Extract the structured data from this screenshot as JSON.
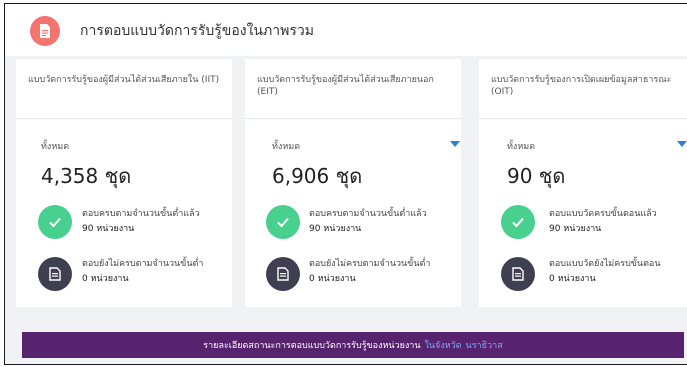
{
  "header": {
    "title": "การตอบแบบวัดการรับรู้ของในภาพรวม",
    "icon": "document-icon",
    "icon_color": "#f47570"
  },
  "cards": [
    {
      "title": "แบบวัดการรับรู้ของผู้มีส่วนได้ส่วนเสียภายใน (IIT)",
      "total_label": "ทั้งหมด",
      "total": "4,358 ชุด",
      "done_label": "ตอบครบตามจำนวนขั้นต่ำแล้ว",
      "done_value": "90 หน่วยงาน",
      "pending_label": "ตอบยังไม่ครบตามจำนวนขั้นต่ำ",
      "pending_value": "0 หน่วยงาน"
    },
    {
      "title": "แบบวัดการรับรู้ของผู้มีส่วนได้ส่วนเสียภายนอก (EIT)",
      "total_label": "ทั้งหมด",
      "total": "6,906 ชุด",
      "done_label": "ตอบครบตามจำนวนขั้นต่ำแล้ว",
      "done_value": "90 หน่วยงาน",
      "pending_label": "ตอบยังไม่ครบตามจำนวนขั้นต่ำ",
      "pending_value": "0 หน่วยงาน"
    },
    {
      "title": "แบบวัดการรับรู้ของการเปิดเผยข้อมูลสาธารณะ (OIT)",
      "total_label": "ทั้งหมด",
      "total": "90 ชุด",
      "done_label": "ตอบแบบวัดครบขั้นตอนแล้ว",
      "done_value": "90 หน่วยงาน",
      "pending_label": "ตอบแบบวัดยังไม่ครบขั้นตอน",
      "pending_value": "0 หน่วยงาน"
    }
  ],
  "colors": {
    "done_icon": "#48d08f",
    "pending_icon": "#3e3f51",
    "banner_bg": "#58236e",
    "link": "#7fa8ff"
  },
  "banner": {
    "text": "รายละเอียดสถานะการตอบแบบวัดการรับรู้ของหน่วยงาน",
    "link1": "ในจังหวัด",
    "link2": "นราธิวาส"
  }
}
